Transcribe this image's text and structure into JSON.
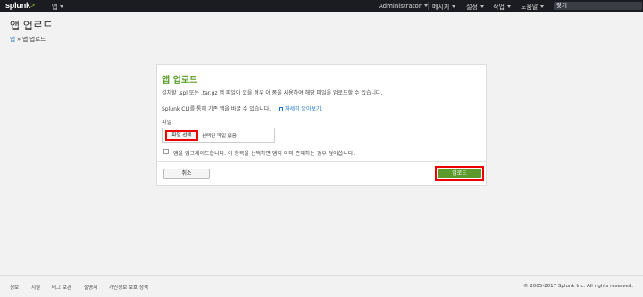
{
  "topbar": {
    "logo": "splunk",
    "logo_suffix": ">",
    "app_menu": "앱",
    "nav": [
      "Administrator",
      "메시지",
      "설정",
      "작업",
      "도움말"
    ],
    "search_placeholder": "찾기"
  },
  "page": {
    "title": "앱 업로드",
    "breadcrumb_link": "앱",
    "breadcrumb_sep": "»",
    "breadcrumb_current": "앱 업로드"
  },
  "panel": {
    "title": "앱 업로드",
    "description": "설치할 .spl 또는 .tar.gz 앱 파일이 있을 경우 이 폼을 사용하여 해당 파일을 업로드할 수 있습니다.",
    "cli_text": "Splunk CLI를 통해 기존 앱을 바꿀 수 있습니다.",
    "learn_more": "자세히 알아보기.",
    "file_label": "파일",
    "file_button": "파일 선택",
    "file_none": "선택된 파일 없음",
    "upgrade_label": "앱을 업그레이드합니다. 이 항목을 선택하면 앱이 이미 존재하는 경우 덮어씁니다.",
    "cancel": "취소",
    "upload": "업로드"
  },
  "footer": {
    "links": [
      "정보",
      "지원",
      "버그 보관",
      "설명서",
      "개인정보 보호 정책"
    ],
    "copyright": "© 2005-2017 Splunk Inc. All rights reserved."
  }
}
